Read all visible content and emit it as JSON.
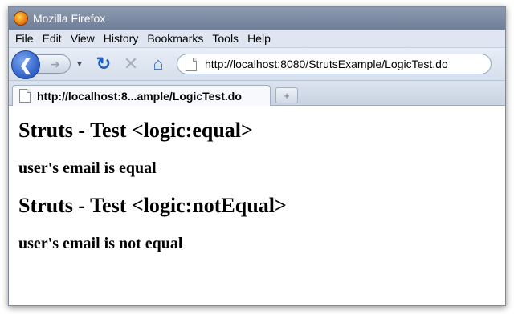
{
  "window": {
    "title": "Mozilla Firefox"
  },
  "menu": [
    "File",
    "Edit",
    "View",
    "History",
    "Bookmarks",
    "Tools",
    "Help"
  ],
  "toolbar": {
    "url": "http://localhost:8080/StrutsExample/LogicTest.do"
  },
  "tab": {
    "title": "http://localhost:8...ample/LogicTest.do"
  },
  "page": {
    "heading1": "Struts - Test <logic:equal>",
    "text1": "user's email is equal",
    "heading2": "Struts - Test <logic:notEqual>",
    "text2": "user's email is not equal"
  }
}
